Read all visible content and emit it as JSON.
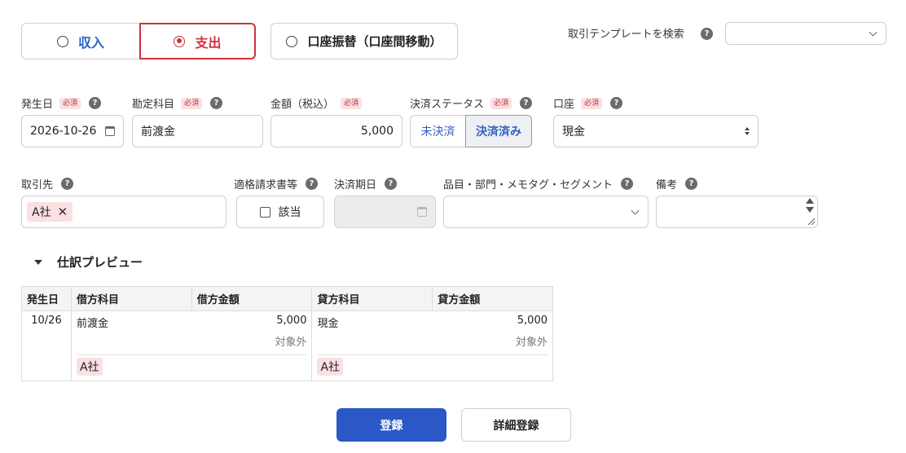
{
  "type_toggle": {
    "income_label": "収入",
    "expense_label": "支出",
    "transfer_label": "口座振替（口座間移動）",
    "selected": "支出"
  },
  "template_search": {
    "label": "取引テンプレートを検索",
    "value": ""
  },
  "help_glyph": "?",
  "required_label": "必須",
  "fields": {
    "date": {
      "label": "発生日",
      "value": "2026-10-26"
    },
    "account_item": {
      "label": "勘定科目",
      "value": "前渡金"
    },
    "amount": {
      "label": "金額（税込）",
      "value": "5,000"
    },
    "settlement_status": {
      "label": "決済ステータス",
      "options": [
        "未決済",
        "決済済み"
      ],
      "selected": "決済済み"
    },
    "wallet": {
      "label": "口座",
      "value": "現金"
    },
    "partner": {
      "label": "取引先",
      "tag": "A社",
      "remove_glyph": "✕"
    },
    "qualified_invoice": {
      "label": "適格請求書等",
      "checkbox_label": "該当",
      "checked": false
    },
    "due_date": {
      "label": "決済期日",
      "value": ""
    },
    "item_dept": {
      "label": "品目・部門・メモタグ・セグメント",
      "value": ""
    },
    "memo": {
      "label": "備考",
      "value": ""
    }
  },
  "preview": {
    "title": "仕訳プレビュー",
    "headers": [
      "発生日",
      "借方科目",
      "借方金額",
      "貸方科目",
      "貸方金額"
    ],
    "row": {
      "date": "10/26",
      "debit_account": "前渡金",
      "debit_amount": "5,000",
      "debit_tax": "対象外",
      "debit_partner": "A社",
      "credit_account": "現金",
      "credit_amount": "5,000",
      "credit_tax": "対象外",
      "credit_partner": "A社"
    }
  },
  "actions": {
    "submit_label": "登録",
    "detail_label": "詳細登録"
  },
  "colors": {
    "expense_accent": "#d0313d",
    "link_blue": "#2f62c7",
    "primary_button": "#2a58c6",
    "required_bg": "#fbe0e3"
  }
}
